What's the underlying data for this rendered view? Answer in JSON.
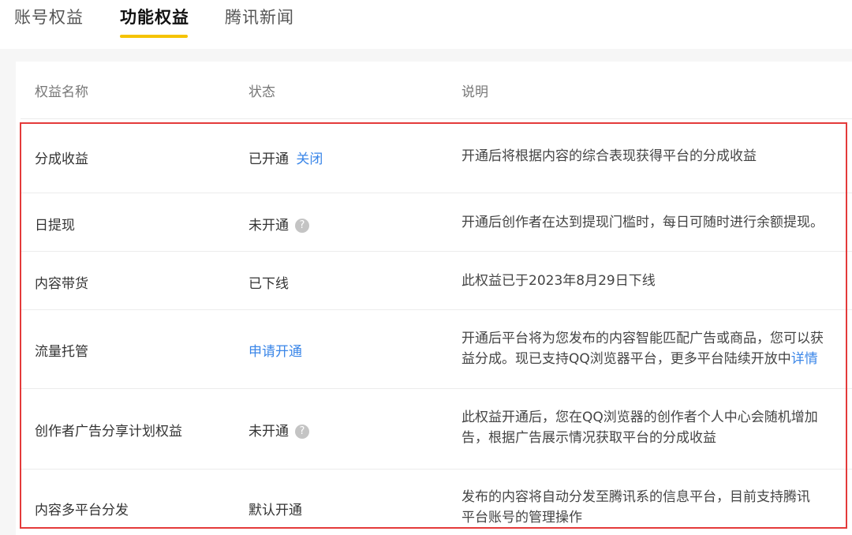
{
  "tabs": [
    "账号权益",
    "功能权益",
    "腾讯新闻"
  ],
  "table": {
    "headers": [
      "权益名称",
      "状态",
      "说明"
    ],
    "rows": [
      {
        "name": "分成收益",
        "status": "已开通",
        "action": "关闭",
        "desc": [
          "开通后将根据内容的综合表现获得平台的分成收益"
        ]
      },
      {
        "name": "日提现",
        "status": "未开通",
        "help": "?",
        "desc": [
          "开通后创作者在达到提现门槛时，每日可随时进行余额提现。"
        ]
      },
      {
        "name": "内容带货",
        "status": "已下线",
        "desc": [
          "此权益已于2023年8月29日下线"
        ]
      },
      {
        "name": "流量托管",
        "action": "申请开通",
        "desc": [
          "开通后平台将为您发布的内容智能匹配广告或商品，您可以获",
          "益分成。现已支持QQ浏览器平台，更多平台陆续开放中"
        ],
        "desc_link": "详情"
      },
      {
        "name": "创作者广告分享计划权益",
        "status": "未开通",
        "help": "?",
        "desc": [
          "此权益开通后，您在QQ浏览器的创作者个人中心会随机增加",
          "告，根据广告展示情况获取平台的分成收益"
        ]
      },
      {
        "name": "内容多平台分发",
        "status": "默认开通",
        "desc": [
          "发布的内容将自动分发至腾讯系的信息平台，目前支持腾讯",
          "平台账号的管理操作"
        ]
      }
    ]
  },
  "colors": {
    "accent_tab_underline": "#f5c300",
    "link": "#3a86e8",
    "highlight_box": "#e43a3a"
  }
}
